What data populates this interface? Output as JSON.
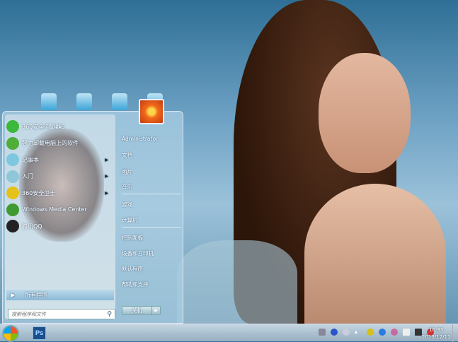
{
  "start_menu": {
    "programs": [
      {
        "label": "360安全浏览器6",
        "icon": "360-browser-icon",
        "color": "#3cb83c",
        "submenu": false
      },
      {
        "label": "强力卸载电脑上的软件",
        "icon": "uninstall-icon",
        "color": "#4fae3a",
        "submenu": false
      },
      {
        "label": "记事本",
        "icon": "notepad-icon",
        "color": "#7ec7e0",
        "submenu": true
      },
      {
        "label": "入门",
        "icon": "getting-started-icon",
        "color": "#8fc7d8",
        "submenu": true
      },
      {
        "label": "360安全卫士",
        "icon": "360-safe-icon",
        "color": "#e5c11b",
        "submenu": true
      },
      {
        "label": "Windows Media Center",
        "icon": "media-center-icon",
        "color": "#3f9a2f",
        "submenu": false
      },
      {
        "label": "腾讯QQ",
        "icon": "qq-icon",
        "color": "#222222",
        "submenu": false
      }
    ],
    "all_programs": "所有程序",
    "search_placeholder": "搜索程序和文件",
    "right_items": [
      "Administrator",
      "文档",
      "图片",
      "音乐",
      "游戏",
      "计算机",
      "控制面板",
      "设备和打印机",
      "默认程序",
      "帮助和支持"
    ],
    "shutdown": "关机"
  },
  "taskbar": {
    "pinned": [
      "Ps"
    ],
    "time": "10:33",
    "date": "2013/12/11"
  }
}
